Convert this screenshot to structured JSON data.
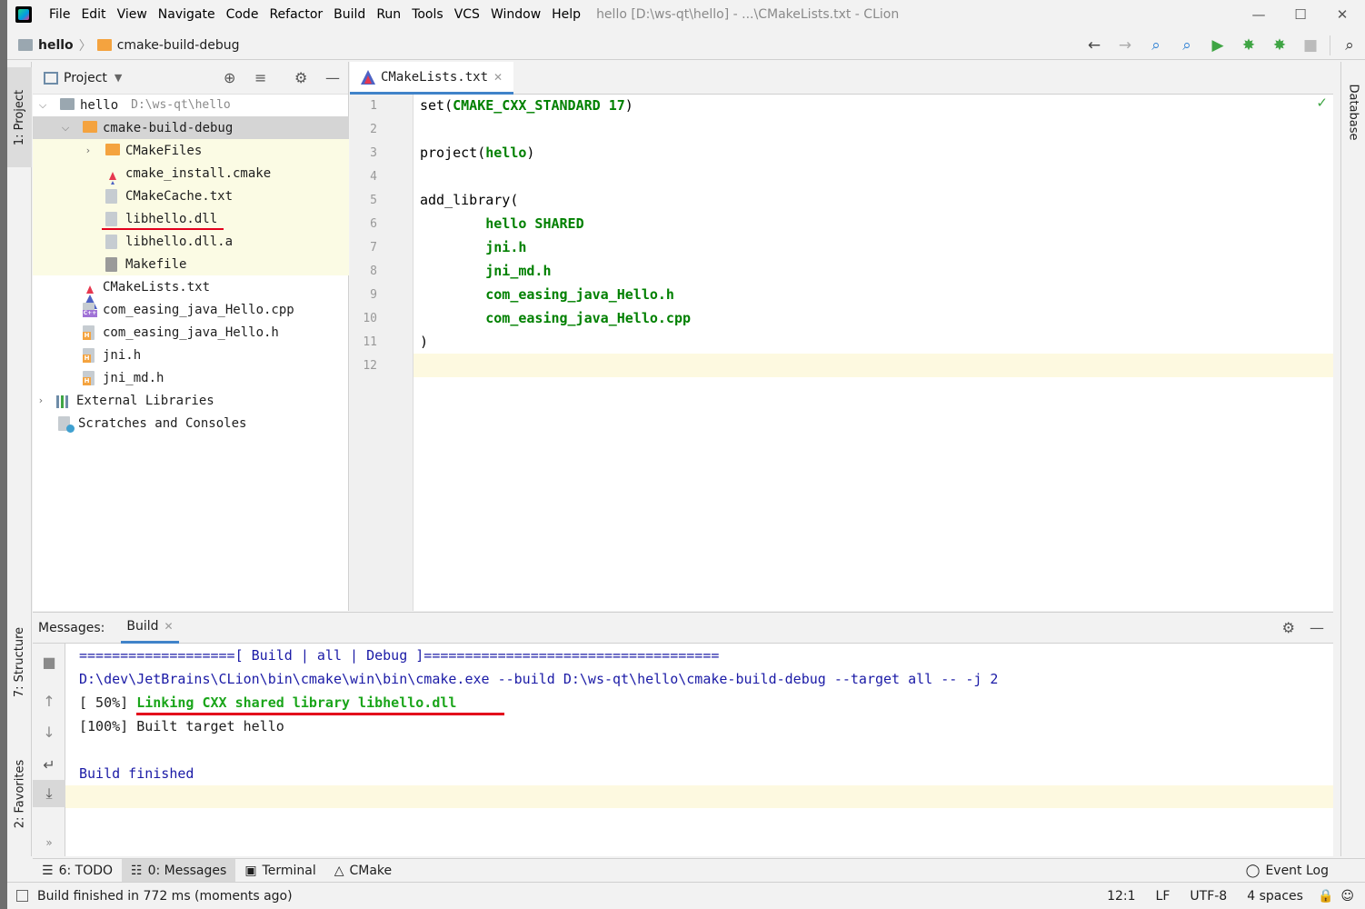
{
  "menu": {
    "items": [
      "File",
      "Edit",
      "View",
      "Navigate",
      "Code",
      "Refactor",
      "Build",
      "Run",
      "Tools",
      "VCS",
      "Window",
      "Help"
    ],
    "window_title": "hello [D:\\ws-qt\\hello] - ...\\CMakeLists.txt - CLion"
  },
  "navbar": {
    "crumbs": [
      "hello",
      "cmake-build-debug"
    ]
  },
  "stripes": {
    "left": [
      "1: Project",
      "7: Structure",
      "2: Favorites"
    ],
    "right": [
      "Database"
    ]
  },
  "project": {
    "title": "Project",
    "root_label": "hello",
    "root_path": "D:\\ws-qt\\hello",
    "rows": [
      {
        "label": "cmake-build-debug"
      },
      {
        "label": "CMakeFiles"
      },
      {
        "label": "cmake_install.cmake"
      },
      {
        "label": "CMakeCache.txt"
      },
      {
        "label": "libhello.dll"
      },
      {
        "label": "libhello.dll.a"
      },
      {
        "label": "Makefile"
      },
      {
        "label": "CMakeLists.txt"
      },
      {
        "label": "com_easing_java_Hello.cpp"
      },
      {
        "label": "com_easing_java_Hello.h"
      },
      {
        "label": "jni.h"
      },
      {
        "label": "jni_md.h"
      },
      {
        "label": "External Libraries"
      },
      {
        "label": "Scratches and Consoles"
      }
    ]
  },
  "editor": {
    "tab": "CMakeLists.txt",
    "line_numbers": [
      "1",
      "2",
      "3",
      "4",
      "5",
      "6",
      "7",
      "8",
      "9",
      "10",
      "11",
      "12"
    ],
    "lines": [
      {
        "pre": "set(",
        "kw": "CMAKE_CXX_STANDARD 17",
        "post": ")"
      },
      {
        "pre": "",
        "kw": "",
        "post": ""
      },
      {
        "pre": "project(",
        "kw": "hello",
        "post": ")"
      },
      {
        "pre": "",
        "kw": "",
        "post": ""
      },
      {
        "pre": "add_library(",
        "kw": "",
        "post": ""
      },
      {
        "pre": "        ",
        "kw": "hello SHARED",
        "post": ""
      },
      {
        "pre": "        ",
        "kw": "jni.h",
        "post": ""
      },
      {
        "pre": "        ",
        "kw": "jni_md.h",
        "post": ""
      },
      {
        "pre": "        ",
        "kw": "com_easing_java_Hello.h",
        "post": ""
      },
      {
        "pre": "        ",
        "kw": "com_easing_java_Hello.cpp",
        "post": ""
      },
      {
        "pre": ")",
        "kw": "",
        "post": ""
      },
      {
        "pre": "",
        "kw": "",
        "post": ""
      }
    ]
  },
  "messages": {
    "label": "Messages:",
    "tab": "Build",
    "line1": "===================[ Build | all | Debug ]====================================",
    "line2": "D:\\dev\\JetBrains\\CLion\\bin\\cmake\\win\\bin\\cmake.exe --build D:\\ws-qt\\hello\\cmake-build-debug --target all -- -j 2",
    "line3_prefix": "[ 50%] ",
    "line3_green": "Linking CXX shared library libhello.dll",
    "line4": "[100%] Built target hello",
    "line5": "Build finished"
  },
  "tool_windows": {
    "todo": "6: TODO",
    "messages": "0: Messages",
    "terminal": "Terminal",
    "cmake": "CMake",
    "event_log": "Event Log"
  },
  "status": {
    "text": "Build finished in 772 ms (moments ago)",
    "position": "12:1",
    "line_sep": "LF",
    "encoding": "UTF-8",
    "indent": "4 spaces"
  },
  "colors": {
    "accent": "#4083c9",
    "keyword": "#008000",
    "console_text": "#1a1aa6",
    "highlight_red": "#e3001b",
    "excluded_bg": "#fbfbe4"
  }
}
